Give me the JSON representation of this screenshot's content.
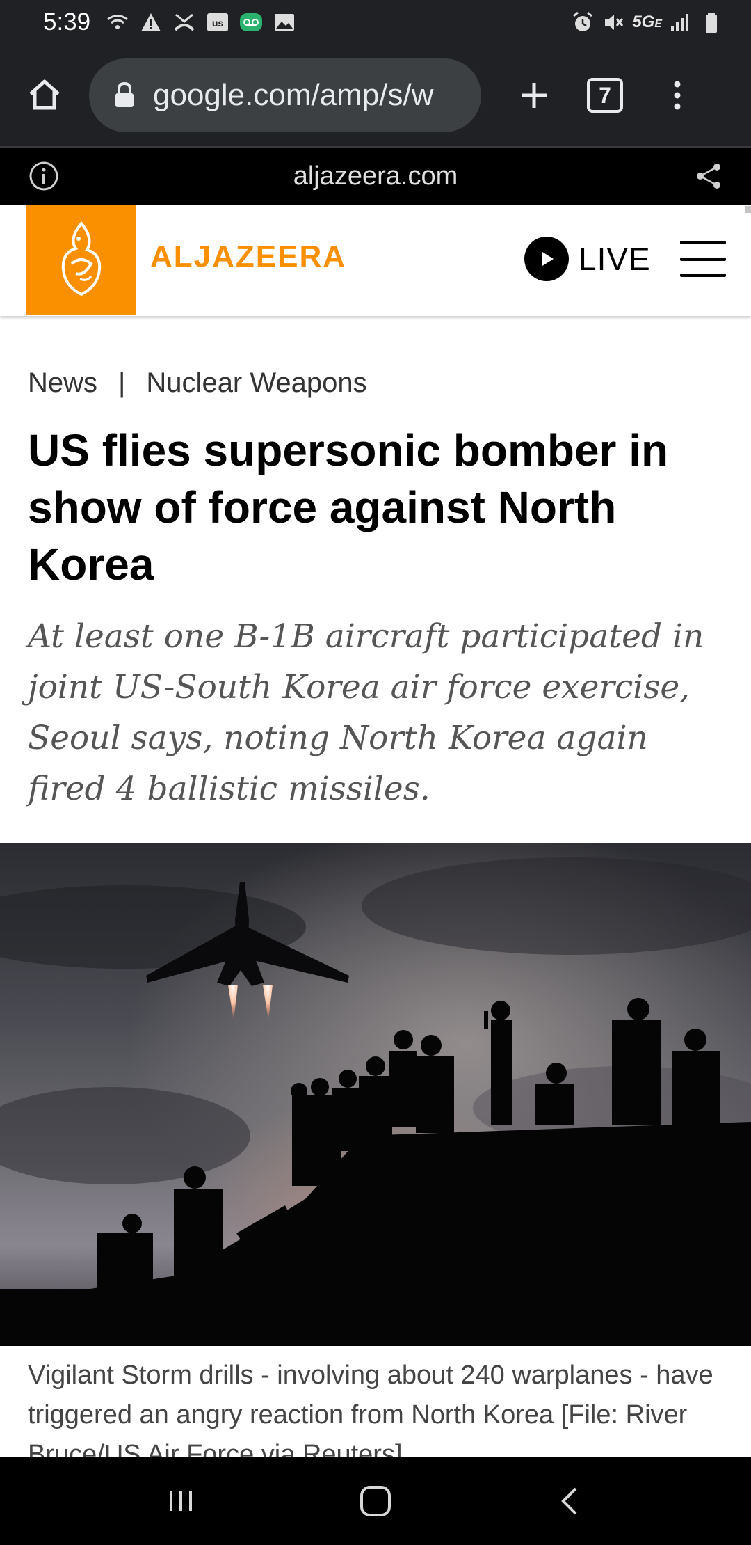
{
  "status_bar": {
    "time": "5:39",
    "network_label": "5G",
    "network_sub": "E"
  },
  "browser": {
    "url": "google.com/amp/s/w",
    "tab_count": "7"
  },
  "amp_header": {
    "domain": "aljazeera.com"
  },
  "site_header": {
    "logo_text": "ALJAZEERA",
    "live_label": "LIVE",
    "brand_color": "#fa9000"
  },
  "article": {
    "breadcrumb": [
      "News",
      "Nuclear Weapons"
    ],
    "breadcrumb_separator": "|",
    "headline": "US flies supersonic bomber in show of force against North Korea",
    "standfirst": "At least one B-1B aircraft participated in joint US-South Korea air force exercise, Seoul says, noting North Korea again fired 4 ballistic missiles.",
    "caption": "Vigilant Storm drills - involving about 240 warplanes - have triggered an angry reaction from North Korea [File: River Bruce/US Air Force via Reuters]"
  },
  "icons": {
    "status_left": [
      "wifi-call-icon",
      "warning-icon",
      "missed-call-icon",
      "us-app-icon",
      "voicemail-icon",
      "gallery-icon"
    ],
    "status_right": [
      "alarm-icon",
      "mute-icon",
      "signal-icon",
      "battery-icon"
    ],
    "toolbar": [
      "home-icon",
      "lock-icon",
      "plus-icon",
      "tab-switcher-icon",
      "more-vert-icon"
    ],
    "nav": [
      "recents-icon",
      "home-nav-icon",
      "back-icon"
    ]
  }
}
